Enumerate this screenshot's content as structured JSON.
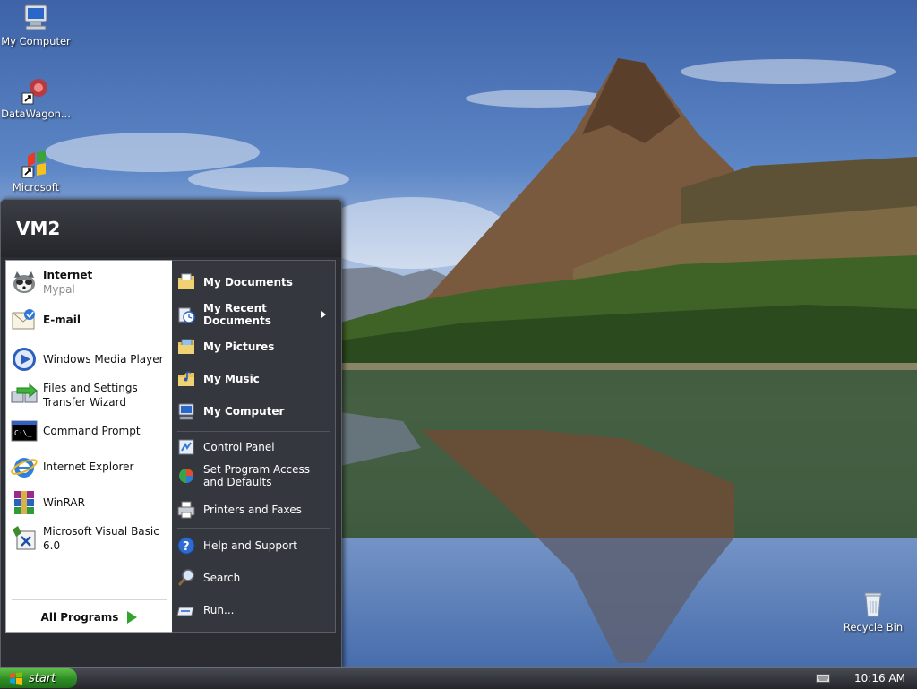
{
  "desktop": {
    "icons": [
      {
        "label": "My Computer",
        "icon": "my-computer-icon"
      },
      {
        "label": "DataWagon...",
        "icon": "datawagon-shortcut-icon"
      },
      {
        "label": "Microsoft",
        "icon": "microsoft-shortcut-icon"
      },
      {
        "label": "Recycle Bin",
        "icon": "recycle-bin-icon"
      }
    ]
  },
  "start_menu": {
    "user": "VM2",
    "pinned": [
      {
        "title": "Internet",
        "subtitle": "Mypal",
        "icon": "mypal-browser-icon"
      },
      {
        "title": "E-mail",
        "icon": "email-icon"
      }
    ],
    "recent": [
      {
        "label": "Windows Media Player",
        "icon": "windows-media-player-icon"
      },
      {
        "label": "Files and Settings Transfer Wizard",
        "icon": "transfer-wizard-icon"
      },
      {
        "label": "Command Prompt",
        "icon": "command-prompt-icon"
      },
      {
        "label": "Internet Explorer",
        "icon": "internet-explorer-icon"
      },
      {
        "label": "WinRAR",
        "icon": "winrar-icon"
      },
      {
        "label": "Microsoft Visual Basic 6.0",
        "icon": "visual-basic-icon"
      }
    ],
    "all_programs": "All Programs",
    "places": [
      {
        "label": "My Documents",
        "icon": "my-documents-icon"
      },
      {
        "label": "My Recent Documents",
        "icon": "my-recent-documents-icon"
      },
      {
        "label": "My Pictures",
        "icon": "my-pictures-icon"
      },
      {
        "label": "My Music",
        "icon": "my-music-icon"
      },
      {
        "label": "My Computer",
        "icon": "my-computer-icon"
      }
    ],
    "settings": [
      {
        "label": "Control Panel",
        "icon": "control-panel-icon"
      },
      {
        "label": "Set Program Access and Defaults",
        "icon": "program-access-icon"
      },
      {
        "label": "Printers and Faxes",
        "icon": "printer-icon"
      }
    ],
    "help": [
      {
        "label": "Help and Support",
        "icon": "help-icon"
      },
      {
        "label": "Search",
        "icon": "search-icon"
      },
      {
        "label": "Run...",
        "icon": "run-icon"
      }
    ]
  },
  "taskbar": {
    "start_label": "start",
    "clock": "10:16 AM"
  },
  "colors": {
    "start_green": "#2e8c24",
    "menu_dark": "#2b2d33"
  }
}
